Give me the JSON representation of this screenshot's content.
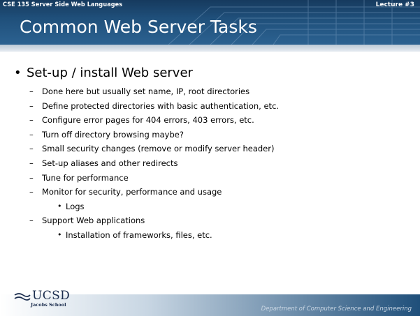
{
  "header": {
    "course": "CSE 135   Server Side Web Languages",
    "lecture": "Lecture #3",
    "title": "Common Web Server Tasks"
  },
  "content": {
    "main_bullet": "Set-up / install Web server",
    "items": [
      "Done here but usually set name, IP, root directories",
      "Define protected  directories with basic authentication,  etc.",
      "Configure error pages for 404 errors, 403 errors, etc.",
      "Turn off directory browsing maybe?",
      "Small security changes (remove or modify server header)",
      "Set-up aliases and other redirects",
      "Tune for performance",
      "Monitor for security, performance and usage",
      "Support Web applications"
    ],
    "monitor_sub": "Logs",
    "support_sub": "Installation of frameworks, files, etc."
  },
  "footer": {
    "logo_text": "UCSD",
    "logo_sub": "Jacobs School",
    "department": "Department of Computer Science and Engineering"
  },
  "colors": {
    "header_dark": "#163a5e",
    "header_light": "#2c6291",
    "logo": "#1a2c4d"
  }
}
